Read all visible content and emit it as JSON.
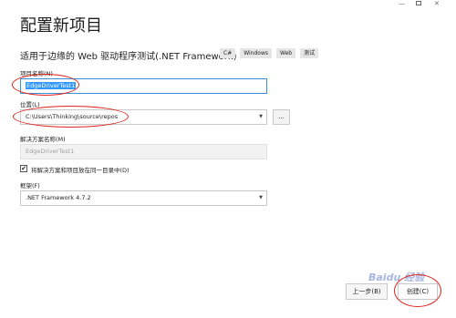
{
  "window": {
    "minimize_glyph": "—",
    "close_glyph": "✕"
  },
  "page": {
    "title": "配置新项目",
    "template_name": "适用于边缘的 Web 驱动程序测试(.NET Framework)",
    "tags": [
      "C#",
      "Windows",
      "Web",
      "测试"
    ]
  },
  "project_name": {
    "label": "项目名称(N)",
    "value": "EdgeDriverTest1"
  },
  "location": {
    "label": "位置(L)",
    "value": "C:\\Users\\Thinking\\source\\repos",
    "browse_label": "..."
  },
  "solution_name": {
    "label": "解决方案名称(M)",
    "value": "EdgeDriverTest1"
  },
  "same_dir": {
    "checked": true,
    "check_glyph": "✔",
    "label": "将解决方案和项目放在同一目录中(D)"
  },
  "framework": {
    "label": "框架(F)",
    "value": ".NET Framework 4.7.2"
  },
  "footer": {
    "back_label": "上一步(B)",
    "create_label": "创建(C)",
    "watermark_text": "Baidu 经验"
  },
  "colors": {
    "accent": "#3d8fd6",
    "selection": "#3399ff",
    "annotation_red": "#e0231b"
  }
}
